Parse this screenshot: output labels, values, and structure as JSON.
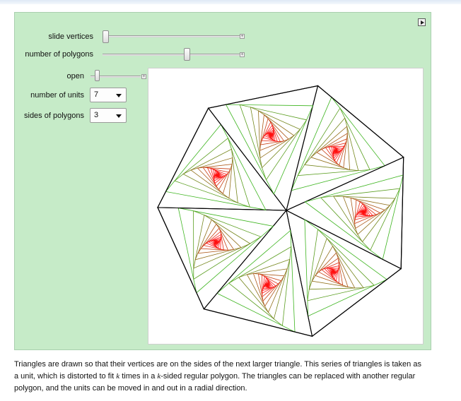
{
  "controls": {
    "slide_vertices": {
      "label": "slide vertices",
      "value": 0.0
    },
    "number_of_polygons": {
      "label": "number of polygons",
      "value": 0.62
    },
    "open": {
      "label": "open",
      "value": 0.1
    },
    "number_of_units": {
      "label": "number of units",
      "value": "7"
    },
    "sides_of_polygons": {
      "label": "sides of polygons",
      "value": "3"
    }
  },
  "caption": {
    "line1": "Triangles are drawn so that their vertices are on the sides of the next larger triangle. This series of triangles is taken as",
    "line2_a": "a unit, which is distorted to fit ",
    "k": "k",
    "line2_b": " times in a ",
    "line2_c": "-sided regular polygon. The triangles can be replaced with another regular",
    "line3": "polygon, and the units can be moved in and out in a radial direction."
  },
  "colors": {
    "panel_bg": "#c6ebc8",
    "outer_line": "#000000",
    "inner_start": "#22cc22",
    "inner_end": "#ff1111"
  }
}
